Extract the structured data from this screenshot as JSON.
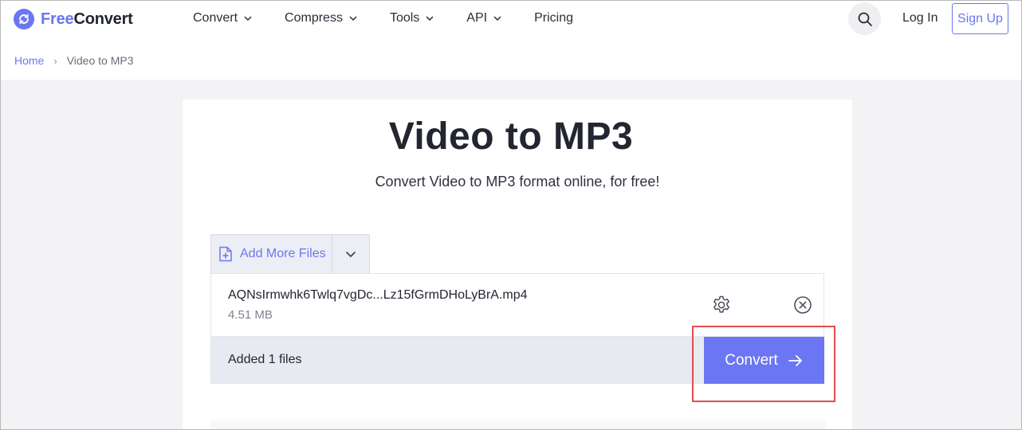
{
  "brand": {
    "prefix": "Free",
    "suffix": "Convert",
    "accent": "#6b76f2"
  },
  "nav": {
    "items": [
      {
        "label": "Convert",
        "has_dropdown": true
      },
      {
        "label": "Compress",
        "has_dropdown": true
      },
      {
        "label": "Tools",
        "has_dropdown": true
      },
      {
        "label": "API",
        "has_dropdown": true
      },
      {
        "label": "Pricing",
        "has_dropdown": false
      }
    ],
    "search_icon": "search-icon",
    "login_label": "Log In",
    "signup_label": "Sign Up"
  },
  "breadcrumb": {
    "home": "Home",
    "separator": "›",
    "current": "Video to MP3"
  },
  "main": {
    "title": "Video to MP3",
    "subtitle": "Convert Video to MP3 format online, for free!",
    "add_files_label": "Add More Files",
    "file": {
      "name": "AQNsIrmwhk6Twlq7vgDc...Lz15fGrmDHoLyBrA.mp4",
      "size": "4.51 MB"
    },
    "files_count": "Added 1 files",
    "convert_label": "Convert"
  },
  "colors": {
    "highlight": "#e34d4d",
    "button": "#6b76f2"
  }
}
